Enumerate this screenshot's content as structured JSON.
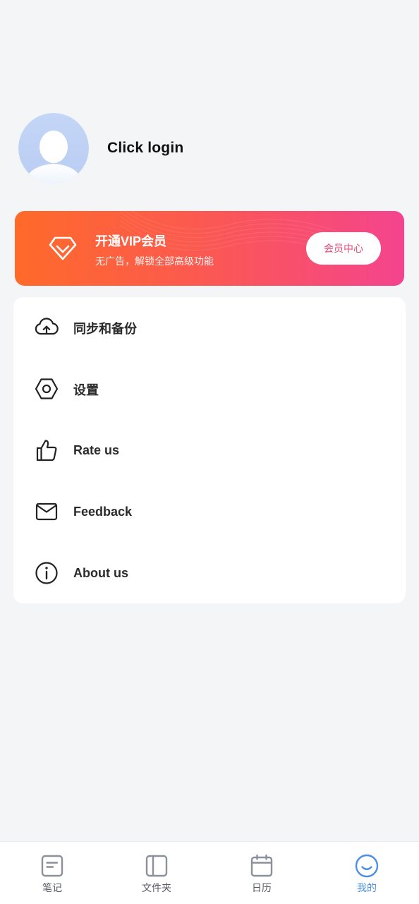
{
  "profile": {
    "login_text": "Click login"
  },
  "vip": {
    "title": "开通VIP会员",
    "subtitle": "无广告，解锁全部高级功能",
    "button_label": "会员中心"
  },
  "menu": {
    "items": [
      {
        "label": "同步和备份",
        "icon": "cloud-upload-icon"
      },
      {
        "label": "设置",
        "icon": "settings-hexagon-icon"
      },
      {
        "label": "Rate us",
        "icon": "thumbs-up-icon"
      },
      {
        "label": "Feedback",
        "icon": "mail-icon"
      },
      {
        "label": "About us",
        "icon": "info-icon"
      }
    ]
  },
  "tabbar": {
    "tabs": [
      {
        "label": "笔记",
        "icon": "note-icon",
        "active": false
      },
      {
        "label": "文件夹",
        "icon": "folder-panel-icon",
        "active": false
      },
      {
        "label": "日历",
        "icon": "calendar-icon",
        "active": false
      },
      {
        "label": "我的",
        "icon": "smile-face-icon",
        "active": true
      }
    ]
  },
  "colors": {
    "background": "#f4f5f7",
    "vip_gradient_start": "#ff6a2a",
    "vip_gradient_end": "#f4448e",
    "active_tab": "#4a8fe6",
    "inactive_tab": "#555a63"
  }
}
